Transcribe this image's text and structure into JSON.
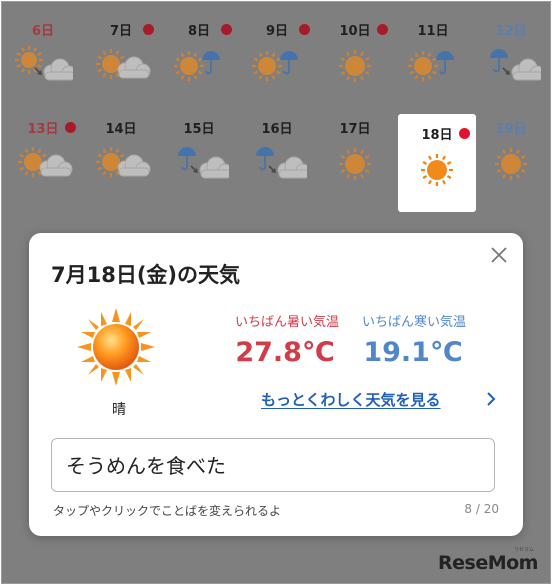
{
  "calendar": {
    "days": [
      {
        "label": "6日",
        "type": "sun",
        "dot": false,
        "icon": "sun-then-cloud-icon"
      },
      {
        "label": "7日",
        "type": "weekday",
        "dot": true,
        "icon": "sun-cloud-icon"
      },
      {
        "label": "8日",
        "type": "weekday",
        "dot": true,
        "icon": "sun-umbrella-icon"
      },
      {
        "label": "9日",
        "type": "weekday",
        "dot": true,
        "icon": "sun-umbrella-icon"
      },
      {
        "label": "10日",
        "type": "weekday",
        "dot": true,
        "icon": "sun-icon"
      },
      {
        "label": "11日",
        "type": "weekday",
        "dot": false,
        "icon": "sun-umbrella-icon"
      },
      {
        "label": "12日",
        "type": "sat",
        "dot": false,
        "icon": "umbrella-cloud-icon"
      },
      {
        "label": "13日",
        "type": "sun",
        "dot": true,
        "icon": "sun-cloud-icon"
      },
      {
        "label": "14日",
        "type": "weekday",
        "dot": false,
        "icon": "sun-cloud-icon"
      },
      {
        "label": "15日",
        "type": "weekday",
        "dot": false,
        "icon": "umbrella-cloud-icon"
      },
      {
        "label": "16日",
        "type": "weekday",
        "dot": false,
        "icon": "umbrella-cloud-icon"
      },
      {
        "label": "17日",
        "type": "weekday",
        "dot": false,
        "icon": "sun-icon"
      },
      {
        "label": "18日",
        "type": "weekday",
        "dot": true,
        "icon": "sun-icon",
        "selected": true
      },
      {
        "label": "19日",
        "type": "sat",
        "dot": false,
        "icon": "sun-icon"
      }
    ]
  },
  "modal": {
    "title": "7月18日(金)の天気",
    "condition": "晴",
    "high_label": "いちばん暑い気温",
    "high_value": "27.8℃",
    "low_label": "いちばん寒い気温",
    "low_value": "19.1℃",
    "detail_link": "もっとくわしく天気を見る",
    "input_value": "そうめんを食べた",
    "hint": "タップやクリックでことばを変えられるよ",
    "counter": "8 / 20"
  },
  "watermark": {
    "logo": "ReseMom",
    "small": "リセマム"
  },
  "colors": {
    "hot": "#d23b48",
    "cold": "#5187c9",
    "link": "#1f5fb8",
    "dot": "#e0142e"
  }
}
